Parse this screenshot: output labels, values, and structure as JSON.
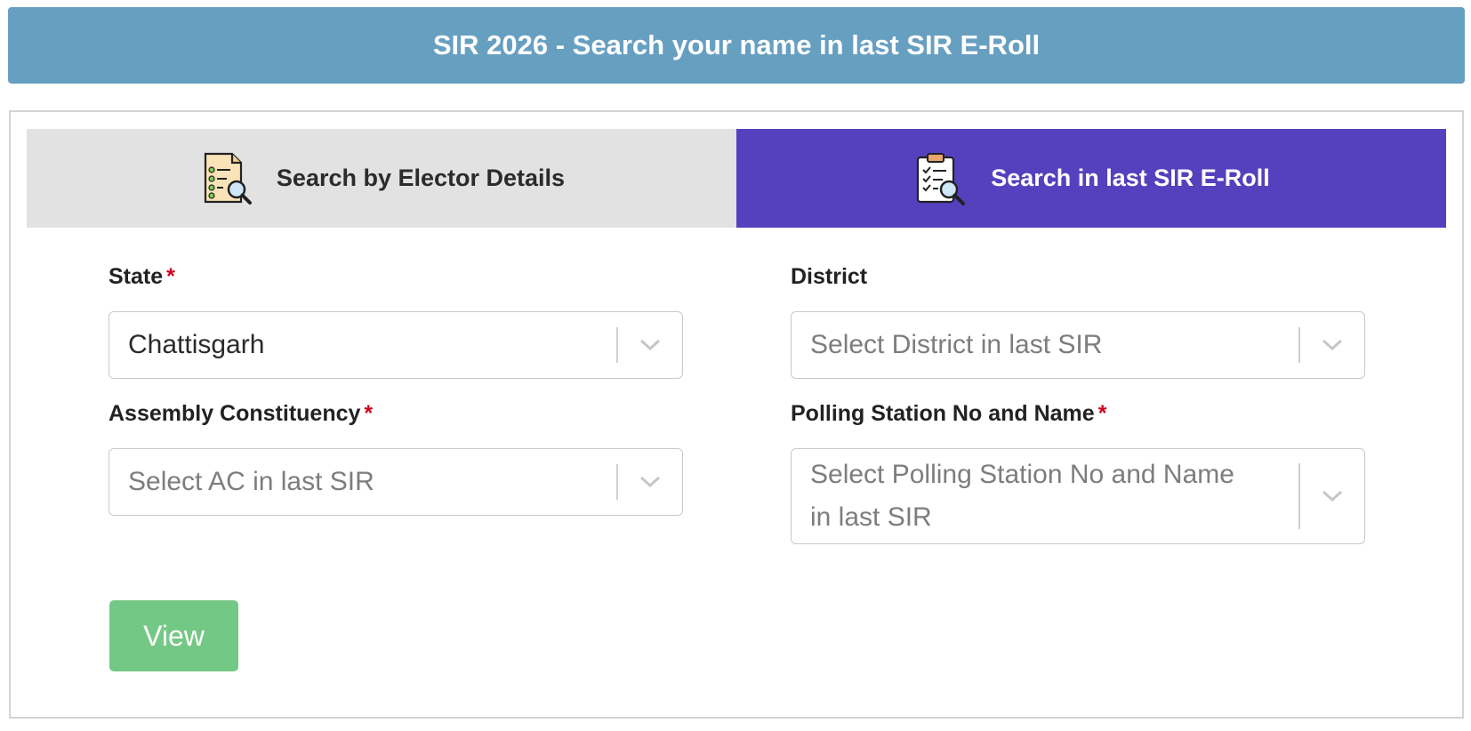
{
  "header": {
    "title": "SIR 2026 - Search your name in last SIR E-Roll"
  },
  "tabs": [
    {
      "label": "Search by Elector Details",
      "icon": "document-search-icon",
      "active": false
    },
    {
      "label": "Search in last SIR E-Roll",
      "icon": "clipboard-search-icon",
      "active": true
    }
  ],
  "form": {
    "state": {
      "label": "State",
      "required_mark": "*",
      "value": "Chattisgarh"
    },
    "district": {
      "label": "District",
      "placeholder": "Select District in last SIR"
    },
    "ac": {
      "label": "Assembly Constituency",
      "required_mark": "*",
      "placeholder": "Select AC in last SIR"
    },
    "polling_station": {
      "label": "Polling Station No and Name",
      "required_mark": "*",
      "placeholder_line1": "Select Polling Station No and Name",
      "placeholder_line2": "in last SIR"
    }
  },
  "actions": {
    "view_label": "View"
  },
  "colors": {
    "header_bg": "#679fc1",
    "active_tab_bg": "#5541be",
    "inactive_tab_bg": "#e2e2e2",
    "view_button_bg": "#74c885",
    "required_mark": "#d0021b"
  }
}
